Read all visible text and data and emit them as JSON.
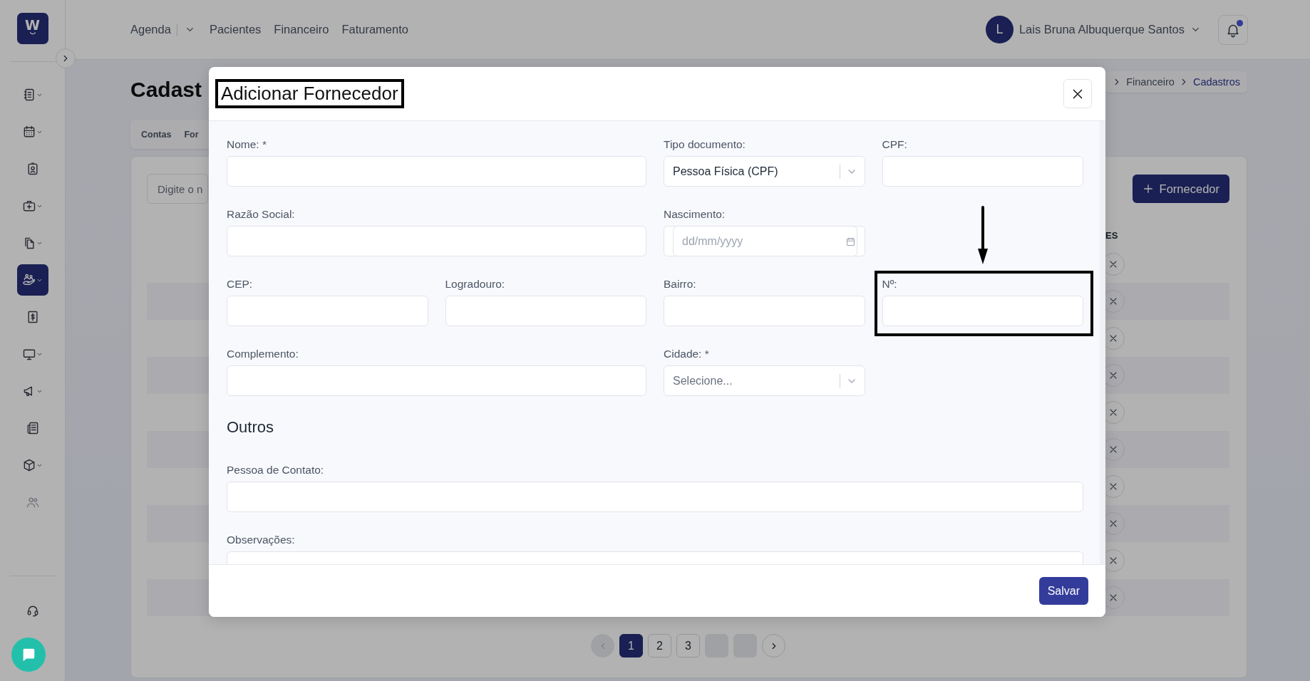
{
  "sidebar": {
    "logo": "W",
    "items": [
      {
        "expandable": true,
        "selected": false,
        "disabled": false
      },
      {
        "expandable": true,
        "selected": false,
        "disabled": false
      },
      {
        "expandable": false,
        "selected": false,
        "disabled": false
      },
      {
        "expandable": true,
        "selected": false,
        "disabled": false
      },
      {
        "expandable": true,
        "selected": false,
        "disabled": false
      },
      {
        "expandable": true,
        "selected": true,
        "disabled": false
      },
      {
        "expandable": false,
        "selected": false,
        "disabled": false
      },
      {
        "expandable": true,
        "selected": false,
        "disabled": false
      },
      {
        "expandable": true,
        "selected": false,
        "disabled": false
      },
      {
        "expandable": false,
        "selected": false,
        "disabled": false
      },
      {
        "expandable": true,
        "selected": false,
        "disabled": false
      },
      {
        "expandable": false,
        "selected": false,
        "disabled": true
      }
    ]
  },
  "header": {
    "nav": [
      {
        "label": "Agenda",
        "dropdown": true
      },
      {
        "label": "Pacientes",
        "dropdown": false
      },
      {
        "label": "Financeiro",
        "dropdown": false
      },
      {
        "label": "Faturamento",
        "dropdown": false
      }
    ],
    "user": {
      "initial": "L",
      "name": "Lais Bruna Albuquerque Santos"
    },
    "notifications": {
      "unread": true
    }
  },
  "page": {
    "title": "Cadast",
    "breadcrumbs": [
      {
        "label": "Financeiro",
        "current": false
      },
      {
        "label": "Cadastros",
        "current": true
      }
    ],
    "tabs": [
      {
        "label": "Contas"
      },
      {
        "label": "For"
      }
    ],
    "search": {
      "placeholder": "Digite o n"
    },
    "add_button": "Fornecedor",
    "table": {
      "columns": [
        "ES"
      ],
      "rows": [
        {
          "removable": true
        },
        {
          "removable": true
        },
        {
          "removable": true
        },
        {
          "removable": true
        },
        {
          "removable": true
        },
        {
          "removable": true
        },
        {
          "removable": true
        },
        {
          "removable": true
        },
        {
          "removable": true
        },
        {
          "removable": true
        }
      ]
    },
    "pagination": {
      "prev_disabled": true,
      "next_disabled": false,
      "pages": [
        {
          "kind": "page",
          "label": "1",
          "selected": true
        },
        {
          "kind": "page",
          "label": "2",
          "selected": false
        },
        {
          "kind": "page",
          "label": "3",
          "selected": false
        },
        {
          "kind": "blank"
        },
        {
          "kind": "blank"
        }
      ]
    }
  },
  "dialog": {
    "title": "Adicionar Fornecedor",
    "title_highlighted": true,
    "rows": [
      [
        {
          "label": "Nome: *",
          "kind": "text-wide",
          "highlighted": false
        },
        "",
        {
          "label": "Tipo documento:",
          "kind": "select",
          "value": "Pessoa Física (CPF)",
          "highlighted": false
        },
        {
          "label": "CPF:",
          "kind": "text",
          "highlighted": false
        }
      ],
      [
        {
          "label": "Razão Social:",
          "kind": "text-wide",
          "highlighted": false
        },
        "",
        {
          "label": "Nascimento:",
          "kind": "date",
          "placeholder": "dd/mm/yyyy",
          "highlighted": false
        }
      ],
      [
        {
          "label": "CEP:",
          "kind": "text",
          "highlighted": false
        },
        {
          "label": "Logradouro:",
          "kind": "text",
          "highlighted": false
        },
        {
          "label": "Bairro:",
          "kind": "text",
          "highlighted": false
        },
        {
          "label": "Nº:",
          "kind": "text",
          "highlighted": true
        }
      ],
      [
        {
          "label": "Complemento:",
          "kind": "text-wide",
          "highlighted": false
        },
        "",
        {
          "label": "Cidade: *",
          "kind": "select",
          "placeholder": "Selecione...",
          "highlighted": false
        }
      ]
    ],
    "sections": [
      {
        "heading": "Outros",
        "rows": [
          [
            {
              "label": "Pessoa de Contato:",
              "kind": "text-full",
              "highlighted": false
            }
          ],
          [
            {
              "label": "Observações:",
              "kind": "text-full",
              "highlighted": false
            }
          ]
        ]
      }
    ],
    "save_button": "Salvar"
  }
}
